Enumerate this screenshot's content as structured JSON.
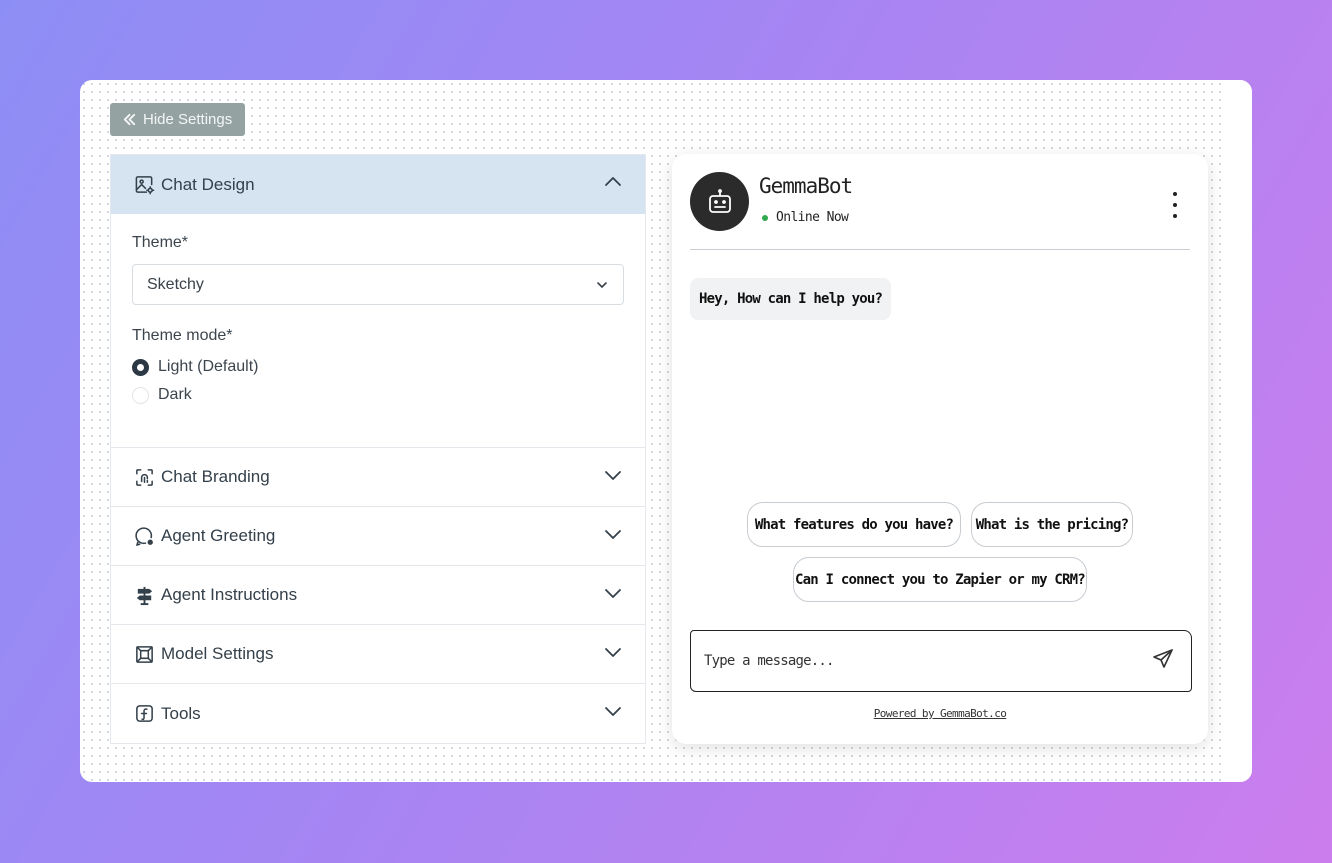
{
  "toolbar": {
    "hide_settings_label": "Hide Settings"
  },
  "settings": {
    "chat_design": {
      "title": "Chat Design",
      "theme_label": "Theme*",
      "theme_value": "Sketchy",
      "theme_mode_label": "Theme mode*",
      "modes": [
        {
          "label": "Light (Default)",
          "checked": true
        },
        {
          "label": "Dark",
          "checked": false
        }
      ]
    },
    "sections": [
      {
        "title": "Chat Branding",
        "icon": "fingerprint-scan-icon"
      },
      {
        "title": "Agent Greeting",
        "icon": "chat-gear-icon"
      },
      {
        "title": "Agent Instructions",
        "icon": "signpost-icon"
      },
      {
        "title": "Model Settings",
        "icon": "frame-icon"
      },
      {
        "title": "Tools",
        "icon": "function-icon"
      }
    ]
  },
  "chat": {
    "bot_name": "GemmaBot",
    "status": "Online Now",
    "greeting": "Hey, How can I help you?",
    "suggestions": [
      "What features do you have?",
      "What is the pricing?",
      "Can I connect you to Zapier or my CRM?"
    ],
    "input_placeholder": "Type a message...",
    "powered_by": "Powered by GemmaBot.co"
  },
  "colors": {
    "accent_header": "#d6e4f2",
    "hide_button": "#94a3a1",
    "status_online": "#2fa84f"
  }
}
